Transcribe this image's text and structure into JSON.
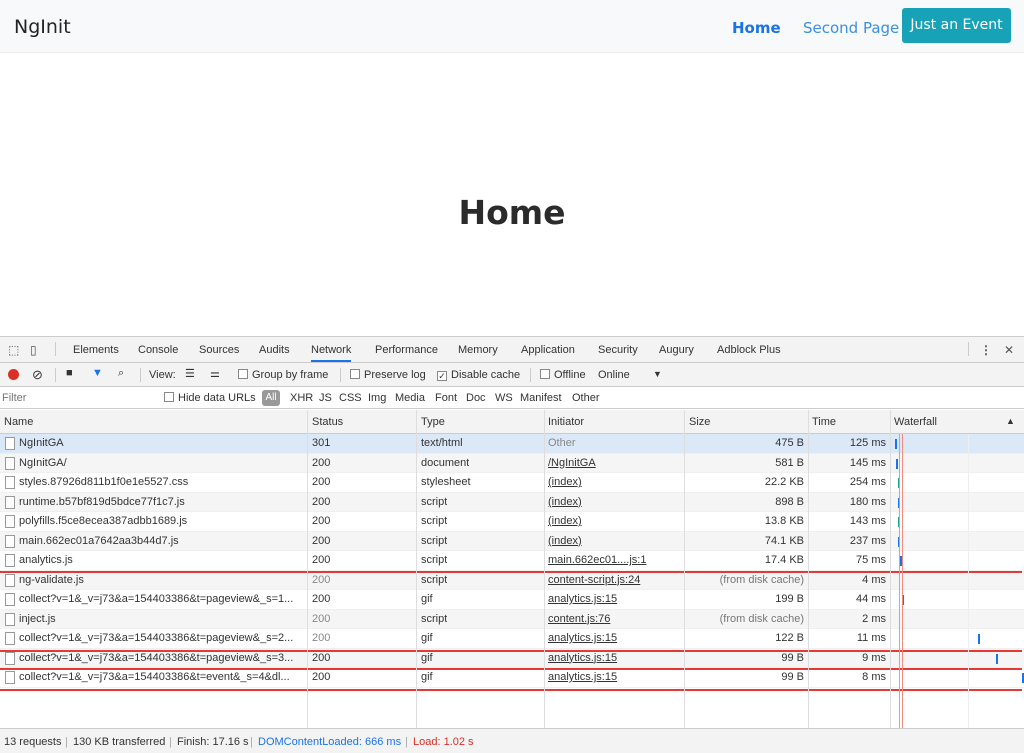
{
  "app": {
    "brand": "NgInit",
    "nav": {
      "home": "Home",
      "second": "Second Page",
      "event_button": "Just an Event"
    },
    "page_title": "Home"
  },
  "devtools": {
    "tabs": [
      "Elements",
      "Console",
      "Sources",
      "Audits",
      "Network",
      "Performance",
      "Memory",
      "Application",
      "Security",
      "Augury",
      "Adblock Plus"
    ],
    "active_tab": "Network",
    "toolbar": {
      "view_label": "View:",
      "group_by_frame": "Group by frame",
      "preserve_log": "Preserve log",
      "disable_cache": "Disable cache",
      "offline": "Offline",
      "throttle": "Online"
    },
    "filter": {
      "placeholder": "Filter",
      "hide_data_urls": "Hide data URLs",
      "types": [
        "All",
        "XHR",
        "JS",
        "CSS",
        "Img",
        "Media",
        "Font",
        "Doc",
        "WS",
        "Manifest",
        "Other"
      ]
    },
    "columns": {
      "name": "Name",
      "status": "Status",
      "type": "Type",
      "initiator": "Initiator",
      "size": "Size",
      "time": "Time",
      "waterfall": "Waterfall"
    },
    "rows": [
      {
        "name": "NgInitGA",
        "status": "301",
        "type": "text/html",
        "initiator": "Other",
        "size": "475 B",
        "time": "125 ms"
      },
      {
        "name": "NgInitGA/",
        "status": "200",
        "type": "document",
        "initiator": "/NgInitGA",
        "size": "581 B",
        "time": "145 ms"
      },
      {
        "name": "styles.87926d811b1f0e1e5527.css",
        "status": "200",
        "type": "stylesheet",
        "initiator": "(index)",
        "size": "22.2 KB",
        "time": "254 ms"
      },
      {
        "name": "runtime.b57bf819d5bdce77f1c7.js",
        "status": "200",
        "type": "script",
        "initiator": "(index)",
        "size": "898 B",
        "time": "180 ms"
      },
      {
        "name": "polyfills.f5ce8ecea387adbb1689.js",
        "status": "200",
        "type": "script",
        "initiator": "(index)",
        "size": "13.8 KB",
        "time": "143 ms"
      },
      {
        "name": "main.662ec01a7642aa3b44d7.js",
        "status": "200",
        "type": "script",
        "initiator": "(index)",
        "size": "74.1 KB",
        "time": "237 ms"
      },
      {
        "name": "analytics.js",
        "status": "200",
        "type": "script",
        "initiator": "main.662ec01....js:1",
        "size": "17.4 KB",
        "time": "75 ms"
      },
      {
        "name": "ng-validate.js",
        "status": "200",
        "type": "script",
        "initiator": "content-script.js:24",
        "size": "(from disk cache)",
        "time": "4 ms"
      },
      {
        "name": "collect?v=1&_v=j73&a=154403386&t=pageview&_s=1...",
        "status": "200",
        "type": "gif",
        "initiator": "analytics.js:15",
        "size": "199 B",
        "time": "44 ms"
      },
      {
        "name": "inject.js",
        "status": "200",
        "type": "script",
        "initiator": "content.js:76",
        "size": "(from disk cache)",
        "time": "2 ms"
      },
      {
        "name": "collect?v=1&_v=j73&a=154403386&t=pageview&_s=2...",
        "status": "200",
        "type": "gif",
        "initiator": "analytics.js:15",
        "size": "122 B",
        "time": "11 ms"
      },
      {
        "name": "collect?v=1&_v=j73&a=154403386&t=pageview&_s=3...",
        "status": "200",
        "type": "gif",
        "initiator": "analytics.js:15",
        "size": "99 B",
        "time": "9 ms"
      },
      {
        "name": "collect?v=1&_v=j73&a=154403386&t=event&_s=4&dl...",
        "status": "200",
        "type": "gif",
        "initiator": "analytics.js:15",
        "size": "99 B",
        "time": "8 ms"
      }
    ],
    "summary": {
      "requests": "13 requests",
      "transferred": "130 KB transferred",
      "finish": "Finish: 17.16 s",
      "dom_loaded": "DOMContentLoaded: 666 ms",
      "load": "Load: 1.02 s"
    },
    "colors": {
      "accent": "#1a73e8",
      "record": "#d93025",
      "annotation": "#e53935"
    }
  }
}
